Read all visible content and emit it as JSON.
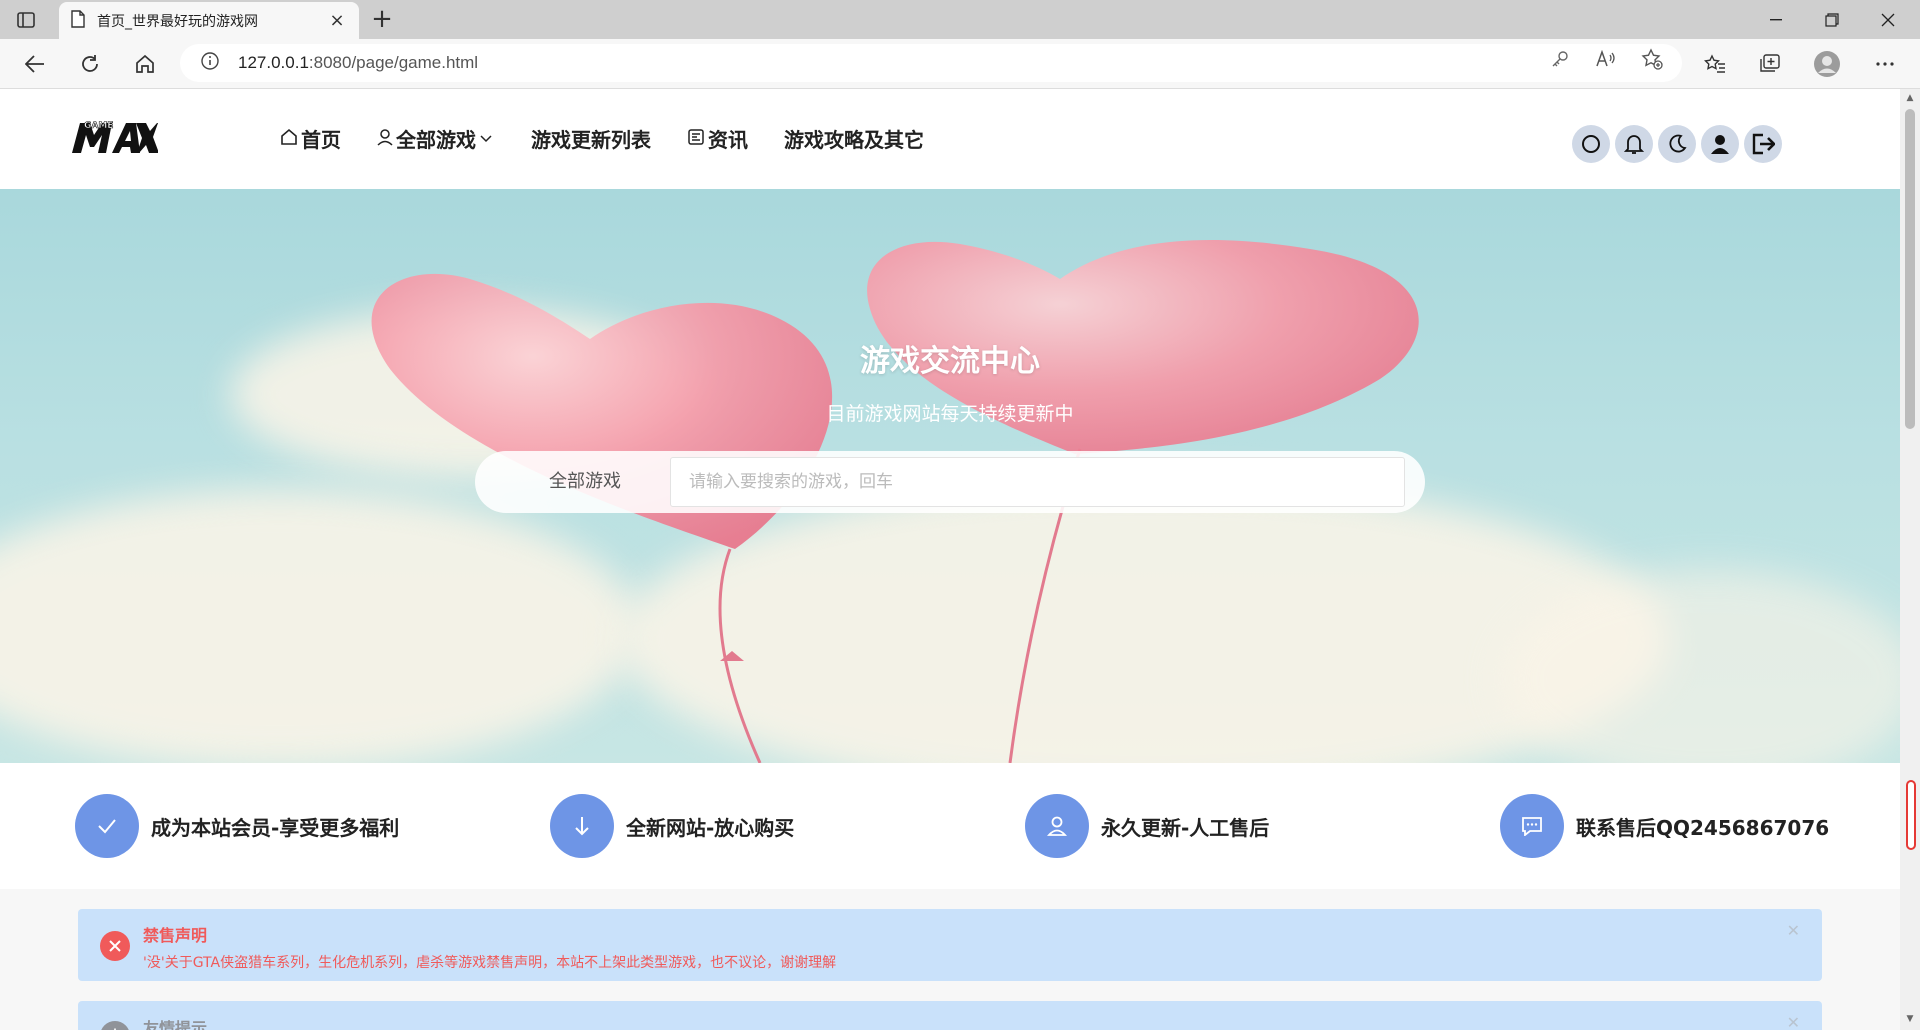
{
  "browser": {
    "tab_title": "首页_世界最好玩的游戏网",
    "url_host": "127.0.0.1",
    "url_rest": ":8080/page/game.html",
    "new_tab_symbol": "+",
    "close_symbol": "×"
  },
  "header": {
    "logo_text": "GAME MAX",
    "nav": [
      {
        "label": "首页",
        "icon": "home-icon"
      },
      {
        "label": "全部游戏",
        "icon": "user-icon",
        "has_dropdown": true
      },
      {
        "label": "游戏更新列表"
      },
      {
        "label": "资讯",
        "icon": "news-icon"
      },
      {
        "label": "游戏攻略及其它"
      }
    ],
    "icons": [
      "search-icon",
      "bell-icon",
      "moon-icon",
      "user-icon",
      "logout-icon"
    ]
  },
  "hero": {
    "title": "游戏交流中心",
    "subtitle": "目前游戏网站每天持续更新中",
    "search_category": "全部游戏",
    "search_placeholder": "请输入要搜索的游戏，回车"
  },
  "features": [
    {
      "icon": "check-icon",
      "text": "成为本站会员-享受更多福利"
    },
    {
      "icon": "arrow-down-icon",
      "text": "全新网站-放心购买"
    },
    {
      "icon": "person-icon",
      "text": "永久更新-人工售后"
    },
    {
      "icon": "chat-icon",
      "text": "联系售后QQ2456867076"
    }
  ],
  "alerts": [
    {
      "title": "禁售声明",
      "desc": "'没'关于GTA侠盗猎车系列，生化危机系列，虐杀等游戏禁售声明，本站不上架此类型游戏，也不议论，谢谢理解",
      "type": "error"
    },
    {
      "title": "友情提示",
      "type": "info"
    }
  ],
  "colors": {
    "accent_blue": "#6e95e6",
    "alert_bg": "#c9e1fa",
    "alert_error": "#f05a5a"
  }
}
